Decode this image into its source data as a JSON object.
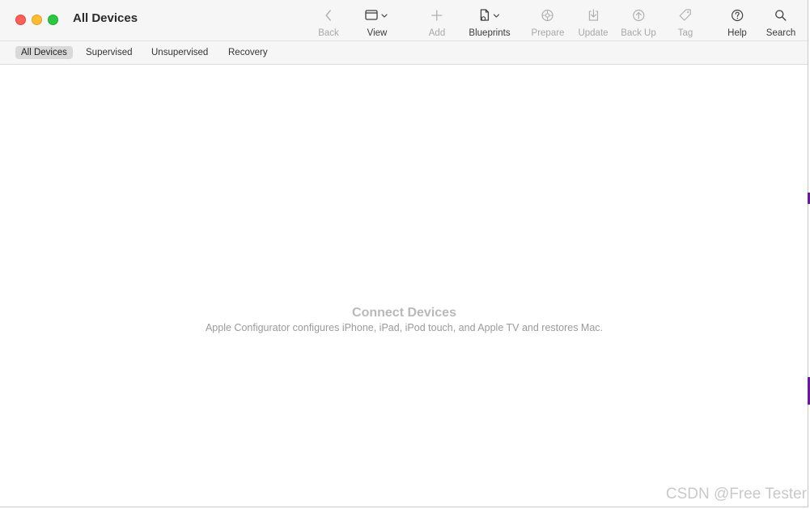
{
  "window": {
    "title": "All Devices"
  },
  "toolbar": {
    "items": [
      {
        "label": "Back",
        "icon": "chevron-left-icon",
        "enabled": false
      },
      {
        "label": "View",
        "icon": "window-view-icon",
        "enabled": true
      },
      {
        "label": "Add",
        "icon": "plus-icon",
        "enabled": false
      },
      {
        "label": "Blueprints",
        "icon": "blueprint-document-icon",
        "enabled": true
      },
      {
        "label": "Prepare",
        "icon": "prepare-gear-icon",
        "enabled": false
      },
      {
        "label": "Update",
        "icon": "update-download-icon",
        "enabled": false
      },
      {
        "label": "Back Up",
        "icon": "backup-upload-icon",
        "enabled": false
      },
      {
        "label": "Tag",
        "icon": "tag-icon",
        "enabled": false
      },
      {
        "label": "Help",
        "icon": "help-question-icon",
        "enabled": true
      },
      {
        "label": "Search",
        "icon": "search-icon",
        "enabled": true
      }
    ]
  },
  "filters": {
    "selected": "All Devices",
    "items": [
      "All Devices",
      "Supervised",
      "Unsupervised",
      "Recovery"
    ]
  },
  "empty_state": {
    "title": "Connect Devices",
    "subtitle": "Apple Configurator configures iPhone, iPad, iPod touch, and Apple TV and restores Mac."
  },
  "watermark": "CSDN @Free Tester",
  "colors": {
    "titlebar": "#f6f6f6",
    "close": "#fe5f57",
    "minimize": "#febc2e",
    "maximize": "#28c840",
    "selected_scope": "#d9d9d9"
  }
}
